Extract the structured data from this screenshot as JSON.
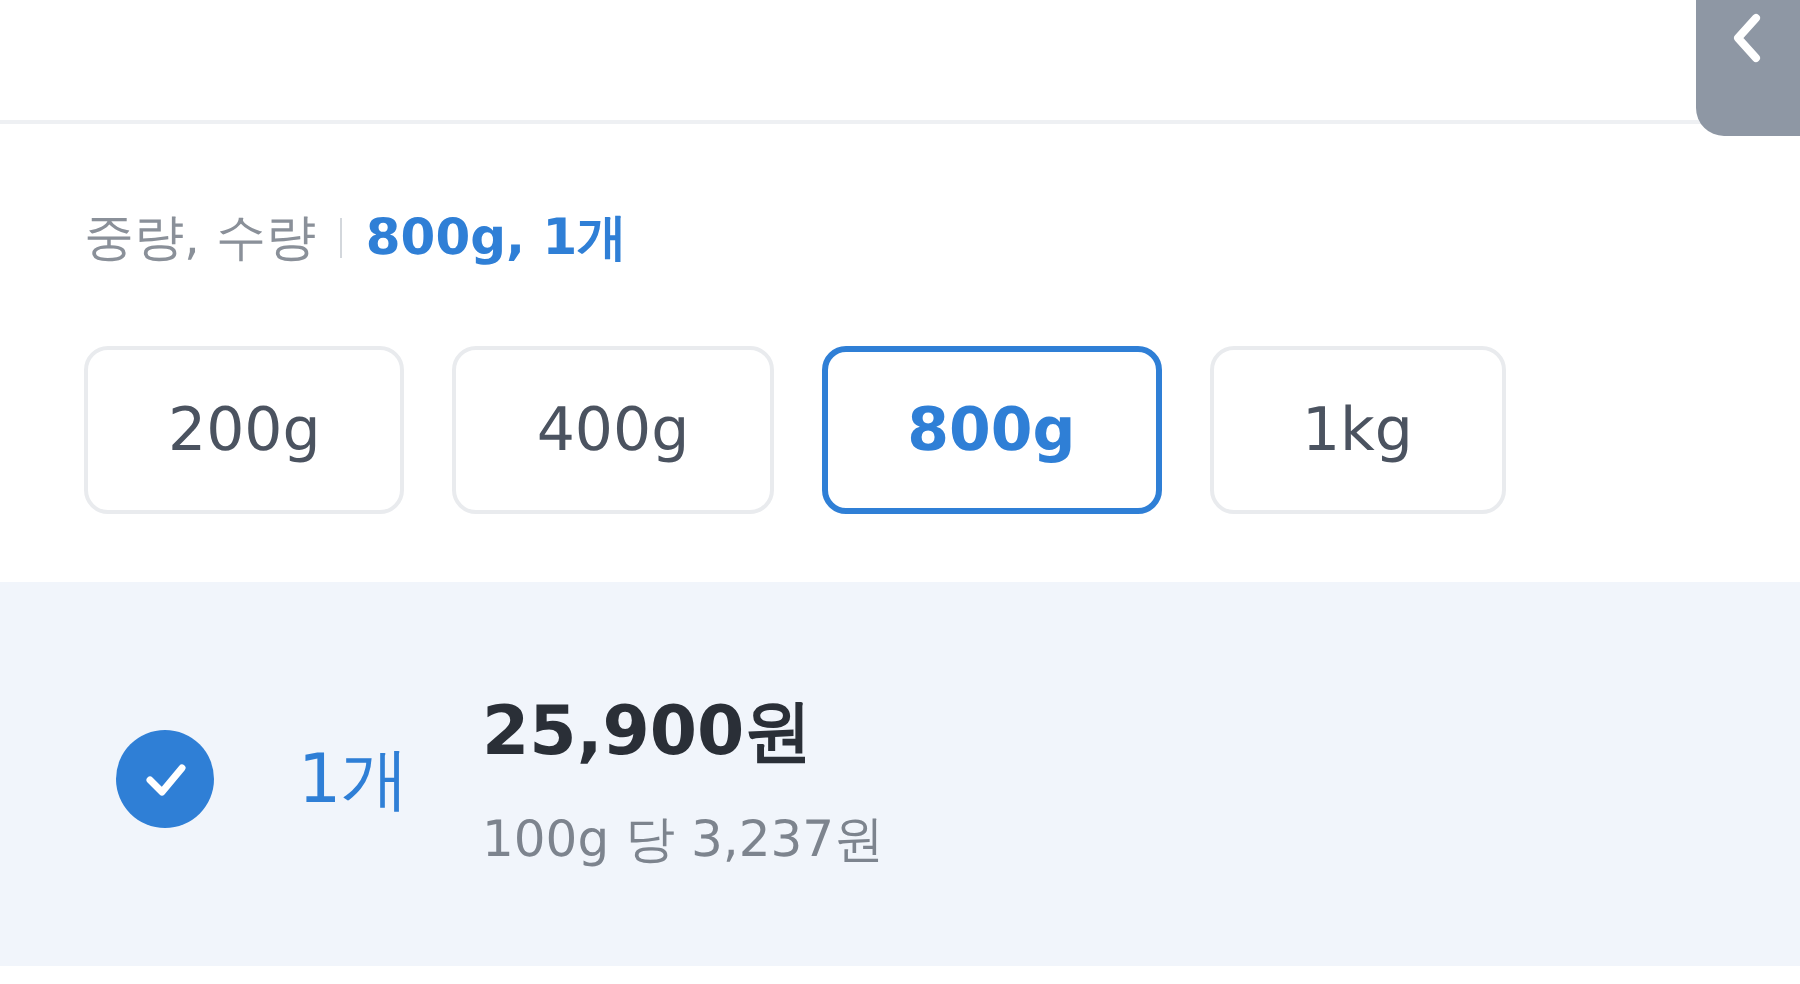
{
  "option": {
    "label": "중량, 수량",
    "selected_value": "800g, 1개"
  },
  "weights": [
    {
      "label": "200g",
      "selected": false
    },
    {
      "label": "400g",
      "selected": false
    },
    {
      "label": "800g",
      "selected": true
    },
    {
      "label": "1kg",
      "selected": false
    }
  ],
  "quantities": [
    {
      "label": "1개",
      "checked": true,
      "price": "25,900원",
      "unit_price": "100g 당 3,237원"
    }
  ]
}
